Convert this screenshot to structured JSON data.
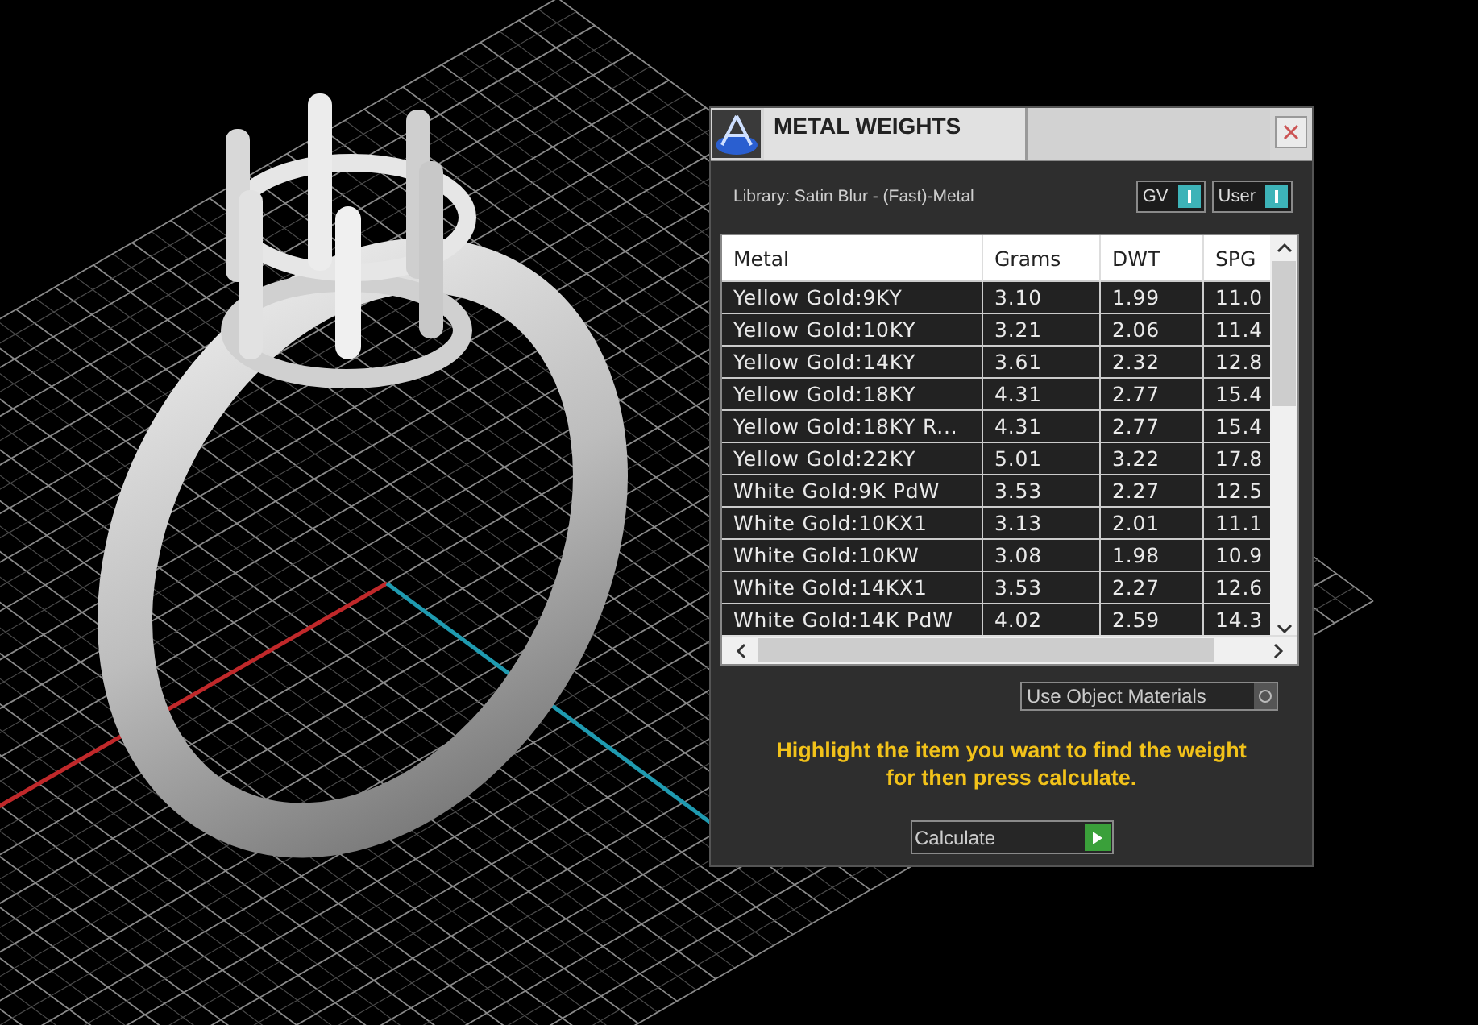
{
  "window": {
    "title": "METAL WEIGHTS"
  },
  "library": "Library: Satin Blur - (Fast)-Metal",
  "toggles": [
    {
      "label": "GV",
      "on": true
    },
    {
      "label": "User",
      "on": true
    }
  ],
  "table": {
    "columns": [
      "Metal",
      "Grams",
      "DWT",
      "SPG"
    ],
    "rows": [
      [
        "Yellow Gold:9KY",
        "3.10",
        "1.99",
        "11.0"
      ],
      [
        "Yellow Gold:10KY",
        "3.21",
        "2.06",
        "11.4"
      ],
      [
        "Yellow Gold:14KY",
        "3.61",
        "2.32",
        "12.8"
      ],
      [
        "Yellow Gold:18KY",
        "4.31",
        "2.77",
        "15.4"
      ],
      [
        "Yellow Gold:18KY R...",
        "4.31",
        "2.77",
        "15.4"
      ],
      [
        "Yellow Gold:22KY",
        "5.01",
        "3.22",
        "17.8"
      ],
      [
        "White Gold:9K PdW",
        "3.53",
        "2.27",
        "12.5"
      ],
      [
        "White Gold:10KX1",
        "3.13",
        "2.01",
        "11.1"
      ],
      [
        "White Gold:10KW",
        "3.08",
        "1.98",
        "10.9"
      ],
      [
        "White Gold:14KX1",
        "3.53",
        "2.27",
        "12.6"
      ],
      [
        "White Gold:14K PdW",
        "4.02",
        "2.59",
        "14.3"
      ]
    ]
  },
  "materials_toggle": {
    "label": "Use Object Materials",
    "on": false
  },
  "hint": "Highlight the item you want to find the weight for then press calculate.",
  "calculate_button": {
    "label": "Calculate"
  }
}
